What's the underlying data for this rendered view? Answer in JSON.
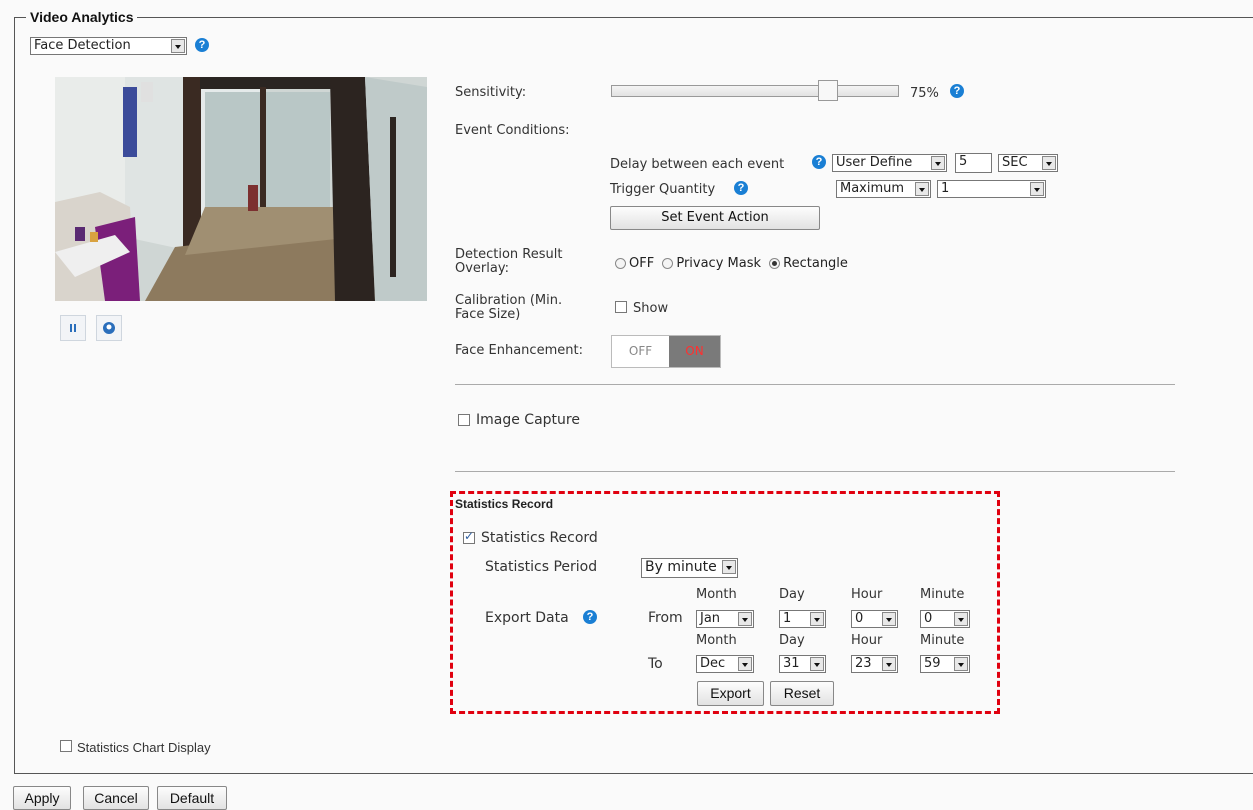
{
  "section_title": "Video Analytics",
  "mode_select": {
    "value": "Face Detection"
  },
  "sensitivity": {
    "label": "Sensitivity:",
    "value_text": "75%",
    "value": 0.75
  },
  "event_conditions": {
    "label": "Event Conditions:",
    "delay_label": "Delay between each event",
    "delay_mode": "User Define",
    "delay_value": "5",
    "delay_unit": "SEC",
    "trigger_label": "Trigger Quantity",
    "trigger_mode": "Maximum",
    "trigger_value": "1",
    "set_action_label": "Set Event Action"
  },
  "overlay": {
    "label_line1": "Detection Result",
    "label_line2": "Overlay:",
    "options": [
      "OFF",
      "Privacy Mask",
      "Rectangle"
    ],
    "selected": "Rectangle"
  },
  "calibration": {
    "label_line1": "Calibration (Min.",
    "label_line2": "Face Size)",
    "checkbox_label": "Show",
    "checked": false
  },
  "face_enhancement": {
    "label": "Face Enhancement:",
    "off_label": "OFF",
    "on_label": "ON",
    "active": "ON"
  },
  "image_capture": {
    "label": "Image Capture",
    "checked": false
  },
  "statistics": {
    "heading": "Statistics Record",
    "record_label": "Statistics Record",
    "record_checked": true,
    "period_label": "Statistics Period",
    "period_value": "By minute",
    "export_label": "Export Data",
    "from_label": "From",
    "to_label": "To",
    "col_month": "Month",
    "col_day": "Day",
    "col_hour": "Hour",
    "col_minute": "Minute",
    "from": {
      "month": "Jan",
      "day": "1",
      "hour": "0",
      "minute": "0"
    },
    "to": {
      "month": "Dec",
      "day": "31",
      "hour": "23",
      "minute": "59"
    },
    "export_button": "Export",
    "reset_button": "Reset"
  },
  "chart_display": {
    "label": "Statistics Chart Display",
    "checked": false
  },
  "footer": {
    "apply": "Apply",
    "cancel": "Cancel",
    "default": "Default"
  },
  "colors": {
    "help_icon": "#1a7fd4",
    "highlight_border": "#e0000f",
    "toggle_on_bg": "#7a7a7a",
    "toggle_on_text": "#ff3030"
  },
  "icons": [
    "help-icon",
    "pause-icon",
    "zoom-icon",
    "dropdown-arrow-icon"
  ]
}
